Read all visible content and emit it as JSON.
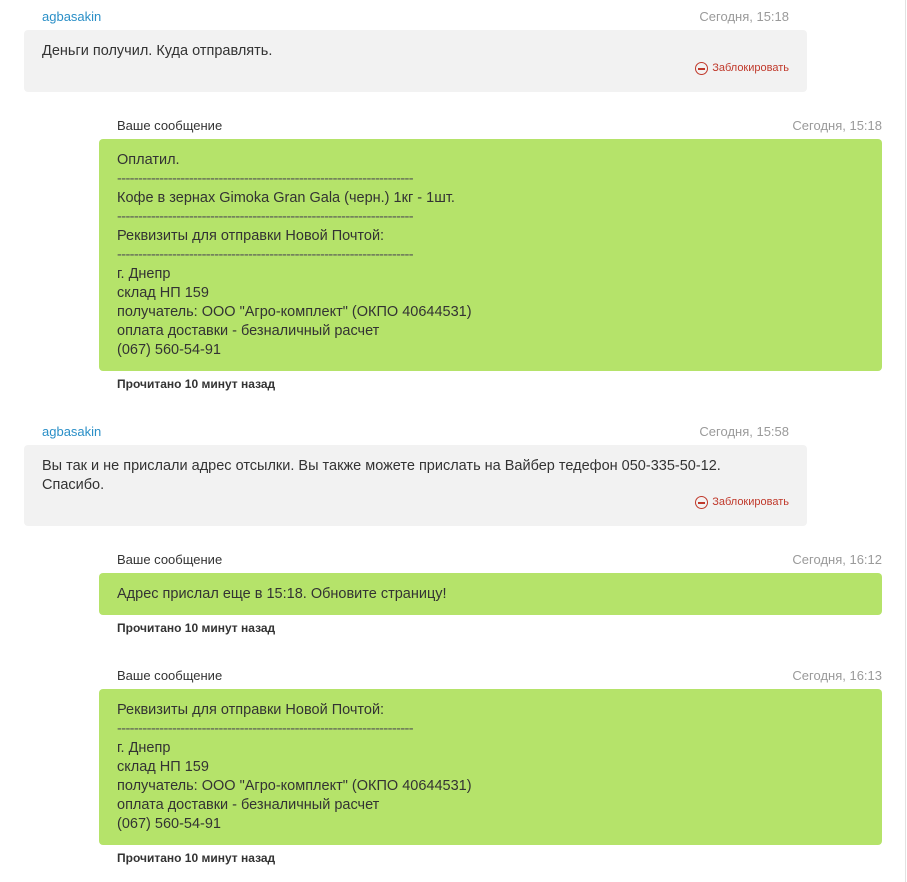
{
  "messages": [
    {
      "author": "agbasakin",
      "time": "Сегодня, 15:18",
      "lines": [
        "Деньги получил. Куда отправлять."
      ],
      "block_label": "Заблокировать"
    },
    {
      "author": "Ваше сообщение",
      "time": "Сегодня, 15:18",
      "lines": [
        "Оплатил.",
        "----------------------------------------------------------------------",
        "Кофе в зернах Gimoka Gran Gala (черн.) 1кг - 1шт.",
        "----------------------------------------------------------------------",
        "Реквизиты для отправки Новой Почтой:",
        "----------------------------------------------------------------------",
        "г. Днепр",
        "склад НП 159",
        "получатель: ООО \"Агро-комплект\" (ОКПО 40644531)",
        "оплата доставки - безналичный расчет",
        "(067) 560-54-91"
      ],
      "read_status": "Прочитано 10 минут назад"
    },
    {
      "author": "agbasakin",
      "time": "Сегодня, 15:58",
      "lines": [
        "Вы так и не прислали адрес отсылки. Вы также можете прислать на Вайбер тедефон 050-335-50-12.",
        "Спасибо."
      ],
      "block_label": "Заблокировать"
    },
    {
      "author": "Ваше сообщение",
      "time": "Сегодня, 16:12",
      "lines": [
        "Адрес прислал еще в 15:18. Обновите страницу!"
      ],
      "read_status": "Прочитано 10 минут назад"
    },
    {
      "author": "Ваше сообщение",
      "time": "Сегодня, 16:13",
      "lines": [
        "Реквизиты для отправки Новой Почтой:",
        "----------------------------------------------------------------------",
        "г. Днепр",
        "склад НП 159",
        "получатель: ООО \"Агро-комплект\" (ОКПО 40644531)",
        "оплата доставки - безналичный расчет",
        "(067) 560-54-91"
      ],
      "read_status": "Прочитано 10 минут назад"
    }
  ]
}
